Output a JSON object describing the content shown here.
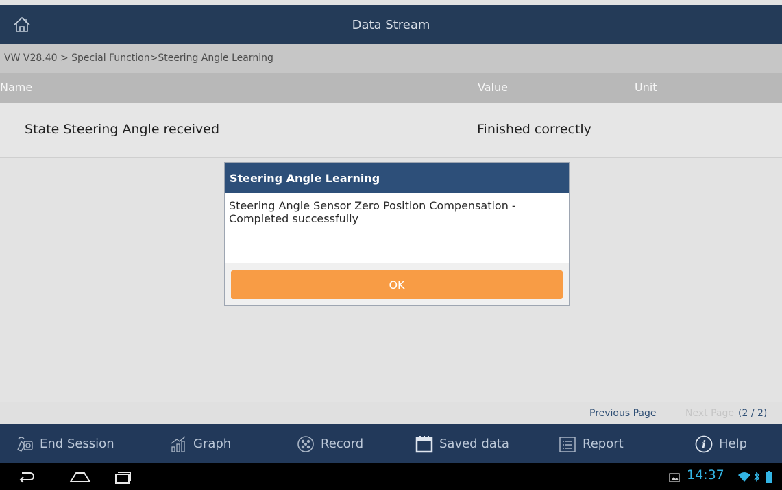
{
  "topbar": {
    "title": "Data Stream",
    "home_icon": "home-icon"
  },
  "breadcrumb": "VW V28.40 > Special Function>Steering Angle Learning",
  "table": {
    "headers": [
      "Name",
      "Value",
      "Unit"
    ],
    "rows": [
      {
        "name": "State Steering Angle received",
        "value": "Finished correctly",
        "unit": ""
      }
    ]
  },
  "pager": {
    "previous": "Previous Page",
    "next": "Next Page",
    "count": "(2 / 2)"
  },
  "bottom_bar": {
    "items": [
      {
        "label": "End Session",
        "icon": "end-session-icon"
      },
      {
        "label": "Graph",
        "icon": "graph-icon"
      },
      {
        "label": "Record",
        "icon": "record-icon"
      },
      {
        "label": "Saved data",
        "icon": "saved-data-icon"
      },
      {
        "label": "Report",
        "icon": "report-icon"
      },
      {
        "label": "Help",
        "icon": "help-icon"
      }
    ]
  },
  "dialog": {
    "title": "Steering Angle Learning",
    "message": "Steering Angle Sensor Zero Position Compensation - Completed successfully",
    "ok_label": "OK"
  },
  "status_bar": {
    "time": "14:37"
  },
  "colors": {
    "header": "#243b58",
    "dialog_title": "#2d4f79",
    "ok_button": "#f89c45",
    "clock": "#33b5e5"
  }
}
